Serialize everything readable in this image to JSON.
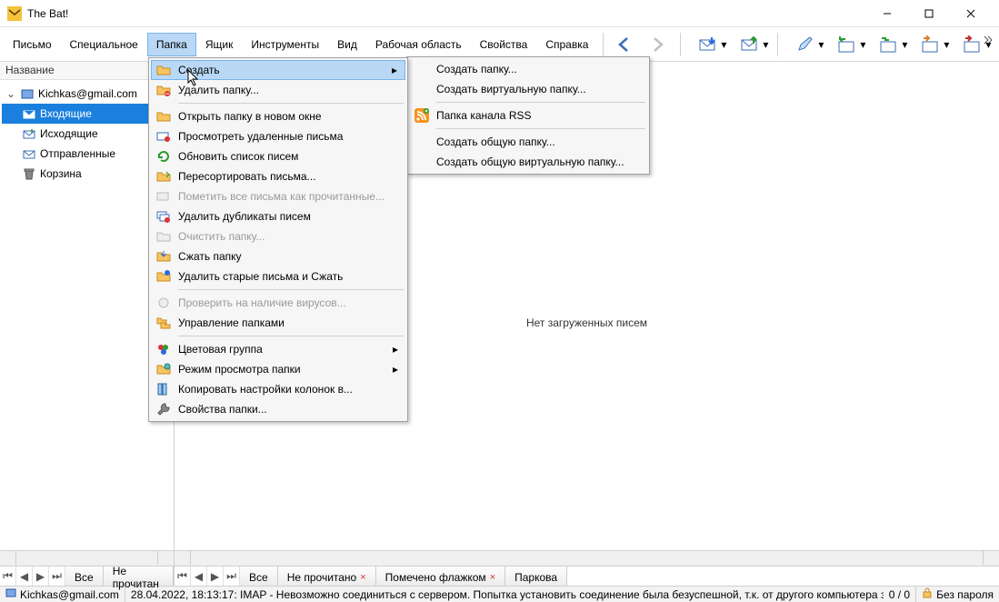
{
  "app": {
    "title": "The Bat!"
  },
  "menu": {
    "items": [
      "Письмо",
      "Специальное",
      "Папка",
      "Ящик",
      "Инструменты",
      "Вид",
      "Рабочая область",
      "Свойства",
      "Справка"
    ],
    "open_index": 2
  },
  "folder_menu": {
    "create": "Создать",
    "delete": "Удалить папку...",
    "open_new": "Открыть папку в новом окне",
    "view_deleted": "Просмотреть удаленные письма",
    "refresh": "Обновить список писем",
    "resort": "Пересортировать письма...",
    "mark_read": "Пометить все письма как прочитанные...",
    "del_dup": "Удалить дубликаты писем",
    "clear": "Очистить папку...",
    "compress": "Сжать папку",
    "del_old": "Удалить старые письма и Сжать",
    "virus": "Проверить на наличие вирусов...",
    "manage": "Управление папками",
    "color": "Цветовая группа",
    "viewmode": "Режим просмотра папки",
    "copycols": "Копировать настройки колонок в...",
    "props": "Свойства папки..."
  },
  "create_submenu": {
    "new_folder": "Создать папку...",
    "virt_folder": "Создать виртуальную папку...",
    "rss": "Папка канала RSS",
    "shared": "Создать общую папку...",
    "shared_virt": "Создать общую виртуальную папку..."
  },
  "sidebar": {
    "header": "Название",
    "account": "Kichkas@gmail.com",
    "folders": [
      "Входящие",
      "Исходящие",
      "Отправленные",
      "Корзина"
    ]
  },
  "content": {
    "empty": "Нет загруженных писем"
  },
  "tabs": {
    "left": [
      "Все",
      "Не прочитан"
    ],
    "right": [
      "Все",
      "Не прочитано",
      "Помечено флажком",
      "Паркова"
    ]
  },
  "status": {
    "account": "Kichkas@gmail.com",
    "log": "28.04.2022, 18:13:17: IMAP  - Невозможно соединиться с сервером. Попытка установить соединение была безуспешной, т.к. от другого компьютера з…",
    "counter": "0 / 0",
    "lock": "Без пароля"
  }
}
